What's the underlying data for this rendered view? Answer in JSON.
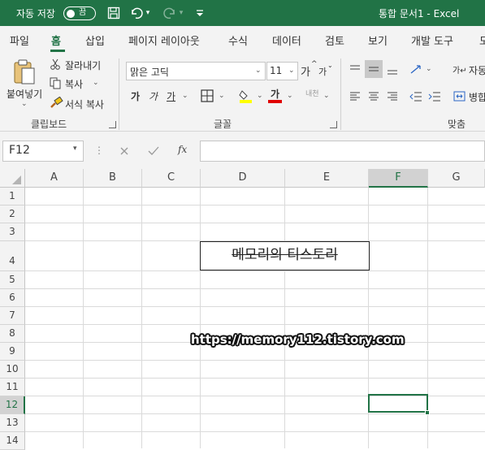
{
  "titlebar": {
    "autosave_label": "자동 저장",
    "autosave_state": "끔",
    "document_title": "통합 문서1  -  Excel",
    "bg_color": "#217346"
  },
  "tabs": [
    {
      "label": "파일"
    },
    {
      "label": "홈",
      "active": true
    },
    {
      "label": "삽입"
    },
    {
      "label": "페이지 레이아웃"
    },
    {
      "label": "수식"
    },
    {
      "label": "데이터"
    },
    {
      "label": "검토"
    },
    {
      "label": "보기"
    },
    {
      "label": "개발 도구"
    },
    {
      "label": "도"
    }
  ],
  "clipboard": {
    "paste_label": "붙여넣기",
    "cut_label": "잘라내기",
    "copy_label": "복사",
    "format_painter_label": "서식 복사",
    "group_label": "클립보드"
  },
  "font": {
    "font_name": "맑은 고딕",
    "font_size": "11",
    "grow_label": "가",
    "shrink_label": "가",
    "bold_label": "가",
    "italic_label": "가",
    "underline_label": "가",
    "color_label": "가",
    "phonetic_label": "내천",
    "group_label": "글꼴",
    "highlight_color": "#ffff00",
    "font_color": "#e00000"
  },
  "alignment": {
    "wrap_label": "자동",
    "merge_label": "병합",
    "group_label": "맞춤"
  },
  "formula_bar": {
    "name_box": "F12",
    "fx_label": "fx",
    "formula": ""
  },
  "sheet": {
    "columns": [
      "A",
      "B",
      "C",
      "D",
      "E",
      "F",
      "G"
    ],
    "selected_column": "F",
    "rows": [
      "1",
      "2",
      "3",
      "4",
      "5",
      "6",
      "7",
      "8",
      "9",
      "10",
      "11",
      "12",
      "13",
      "14"
    ],
    "selected_row": "12",
    "cell_d4_text": "메모리의 티스토리",
    "watermark_text": "https://memory112.tistory.com"
  }
}
